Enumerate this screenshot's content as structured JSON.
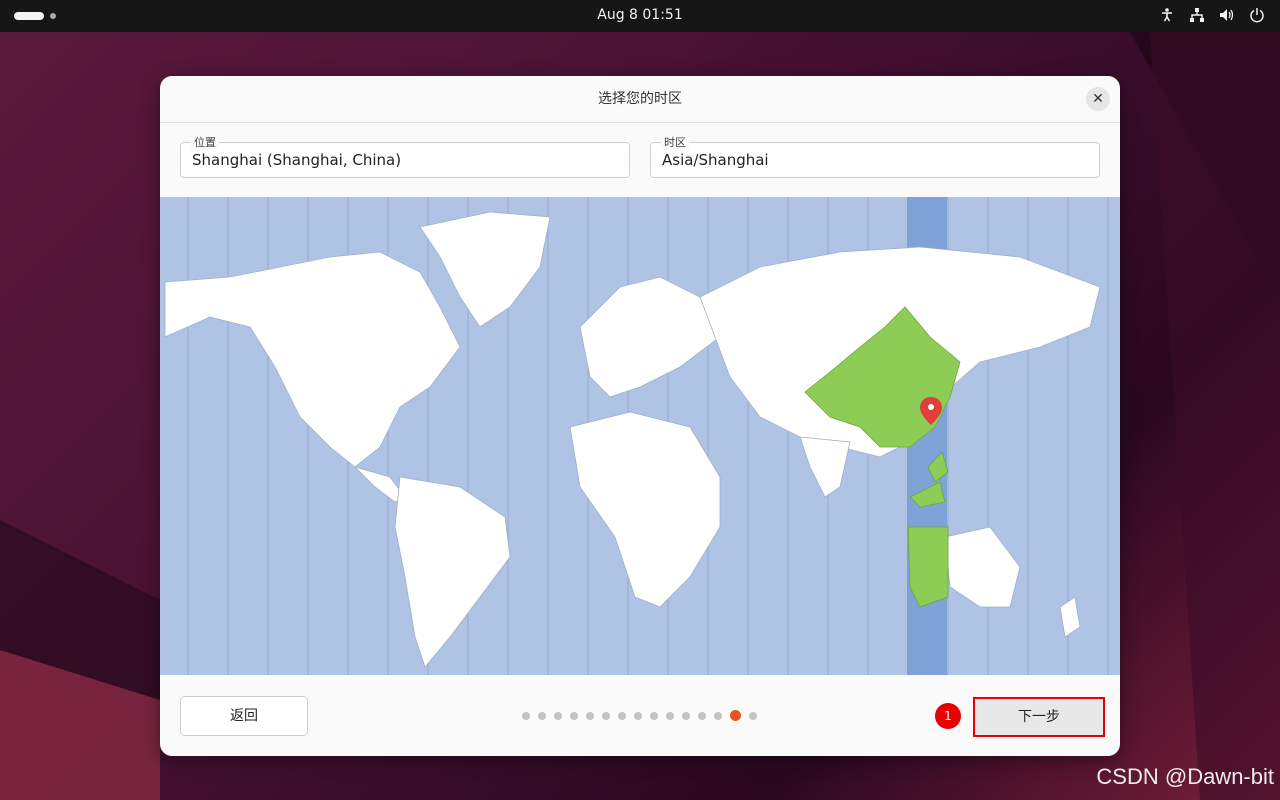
{
  "topbar": {
    "clock": "Aug 8  01:51",
    "icons": [
      "activities-pill",
      "workspace-dot",
      "accessibility-icon",
      "network-icon",
      "volume-icon",
      "power-icon"
    ]
  },
  "dialog": {
    "title": "选择您的时区",
    "close_icon": "close-icon",
    "location": {
      "label": "位置",
      "value": "Shanghai (Shanghai, China)"
    },
    "timezone": {
      "label": "时区",
      "value": "Asia/Shanghai"
    },
    "map": {
      "ocean_color": "#afc3e5",
      "land_color": "#ffffff",
      "selected_zone_color": "#7fa3d9",
      "selected_country_color": "#8dcd55",
      "pin_color": "#e0403a"
    },
    "footer": {
      "back_label": "返回",
      "next_label": "下一步",
      "step_badge": "1",
      "progress": {
        "total_steps": 15,
        "current_step": 14,
        "accent": "#e95420"
      }
    }
  },
  "watermark": "CSDN @Dawn-bit"
}
